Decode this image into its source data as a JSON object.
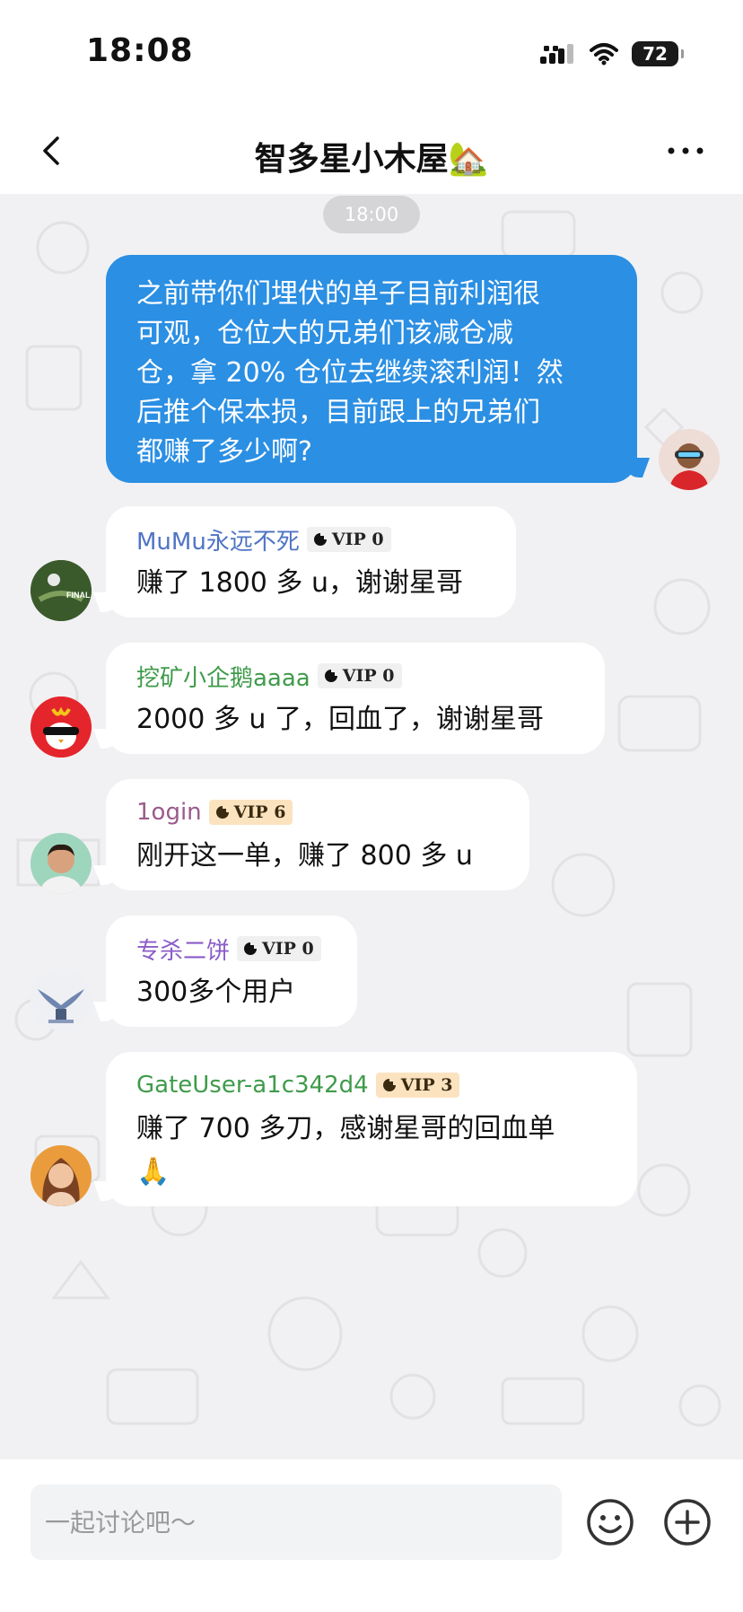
{
  "status_bar": {
    "time": "18:08",
    "battery": "72"
  },
  "nav": {
    "title": "智多星小木屋🏡"
  },
  "chat": {
    "timestamp": "18:00",
    "outgoing": {
      "lines": [
        "之前带你们埋伏的单子目前利润很",
        "可观，仓位大的兄弟们该减仓减",
        "仓，拿 20% 仓位去继续滚利润！然",
        "后推个保本损，目前跟上的兄弟们",
        "都赚了多少啊?"
      ]
    },
    "messages": [
      {
        "sender": "MuMu永远不死",
        "sender_color": "#4f74c4",
        "vip": "VIP 0",
        "text": "赚了 1800 多 u，谢谢星哥"
      },
      {
        "sender": "挖矿小企鹅aaaa",
        "sender_color": "#3f9b4a",
        "vip": "VIP 0",
        "text": "2000 多 u 了，回血了，谢谢星哥"
      },
      {
        "sender": "1ogin",
        "sender_color": "#9a5a8c",
        "vip": "VIP 6",
        "text": "刚开这一单，赚了 800 多 u"
      },
      {
        "sender": "专杀二饼",
        "sender_color": "#8a5cc8",
        "vip": "VIP 0",
        "text": "300多个用户"
      },
      {
        "sender": "GateUser-a1c342d4",
        "sender_color": "#3f9b4a",
        "vip": "VIP 3",
        "text": "赚了 700 多刀，感谢星哥的回血单",
        "emoji": "🙏"
      }
    ]
  },
  "input": {
    "placeholder": "一起讨论吧～"
  },
  "colors": {
    "bubble_out": "#2b8fe3",
    "chat_bg": "#f1f1f3",
    "vip_gold": "#fbe3c0"
  },
  "icons": [
    "back-chevron-icon",
    "more-dots-icon",
    "signal-icon",
    "wifi-icon",
    "battery-icon",
    "smiley-icon",
    "plus-circle-icon",
    "vip-mark-icon"
  ]
}
